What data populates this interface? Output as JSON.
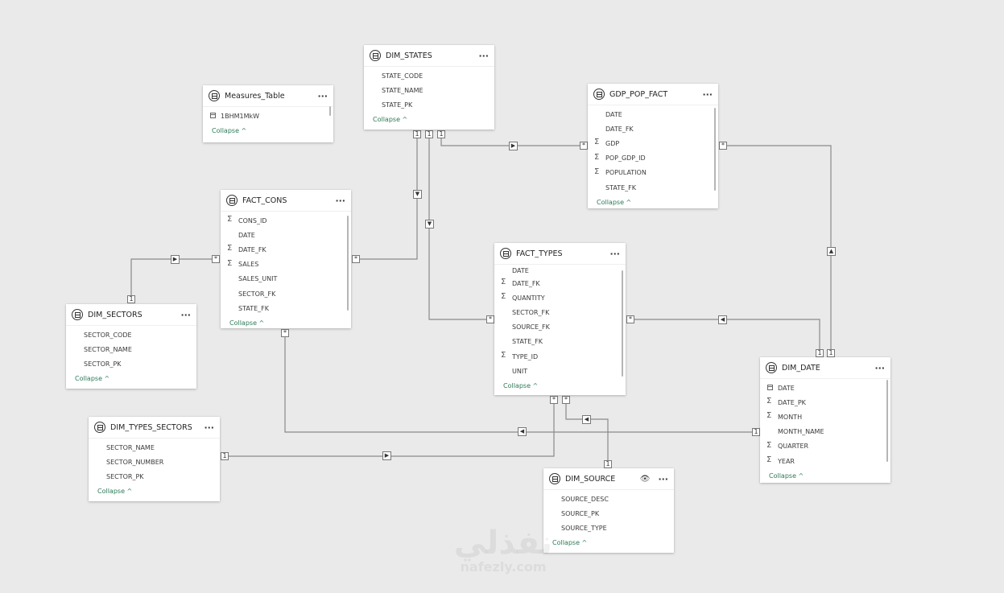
{
  "tables": [
    {
      "id": "dim_states",
      "title": "DIM_STATES",
      "fields": [
        {
          "name": "STATE_CODE",
          "icon": ""
        },
        {
          "name": "STATE_NAME",
          "icon": ""
        },
        {
          "name": "STATE_PK",
          "icon": ""
        }
      ],
      "collapse": "Collapse ^"
    },
    {
      "id": "measures_table",
      "title": "Measures_Table",
      "fields": [
        {
          "name": "1BHM1MkW",
          "icon": "calculator"
        }
      ],
      "collapse": "Collapse ^"
    },
    {
      "id": "gdp_pop_fact",
      "title": "GDP_POP_FACT",
      "fields": [
        {
          "name": "DATE",
          "icon": ""
        },
        {
          "name": "DATE_FK",
          "icon": ""
        },
        {
          "name": "GDP",
          "icon": "sigma"
        },
        {
          "name": "POP_GDP_ID",
          "icon": "sigma"
        },
        {
          "name": "POPULATION",
          "icon": "sigma"
        },
        {
          "name": "STATE_FK",
          "icon": ""
        }
      ],
      "collapse": "Collapse ^"
    },
    {
      "id": "fact_cons",
      "title": "FACT_CONS",
      "fields": [
        {
          "name": "CONS_ID",
          "icon": "sigma"
        },
        {
          "name": "DATE",
          "icon": ""
        },
        {
          "name": "DATE_FK",
          "icon": "sigma"
        },
        {
          "name": "SALES",
          "icon": "sigma"
        },
        {
          "name": "SALES_UNIT",
          "icon": ""
        },
        {
          "name": "SECTOR_FK",
          "icon": ""
        },
        {
          "name": "STATE_FK",
          "icon": ""
        }
      ],
      "collapse": "Collapse ^"
    },
    {
      "id": "fact_types",
      "title": "FACT_TYPES",
      "fields": [
        {
          "name": "DATE",
          "icon": ""
        },
        {
          "name": "DATE_FK",
          "icon": "sigma"
        },
        {
          "name": "QUANTITY",
          "icon": "sigma"
        },
        {
          "name": "SECTOR_FK",
          "icon": ""
        },
        {
          "name": "SOURCE_FK",
          "icon": ""
        },
        {
          "name": "STATE_FK",
          "icon": ""
        },
        {
          "name": "TYPE_ID",
          "icon": "sigma"
        },
        {
          "name": "UNIT",
          "icon": ""
        }
      ],
      "collapse": "Collapse ^"
    },
    {
      "id": "dim_sectors",
      "title": "DIM_SECTORS",
      "fields": [
        {
          "name": "SECTOR_CODE",
          "icon": ""
        },
        {
          "name": "SECTOR_NAME",
          "icon": ""
        },
        {
          "name": "SECTOR_PK",
          "icon": ""
        }
      ],
      "collapse": "Collapse ^"
    },
    {
      "id": "dim_date",
      "title": "DIM_DATE",
      "fields": [
        {
          "name": "DATE",
          "icon": "calendar"
        },
        {
          "name": "DATE_PK",
          "icon": "sigma"
        },
        {
          "name": "MONTH",
          "icon": "sigma"
        },
        {
          "name": "MONTH_NAME",
          "icon": ""
        },
        {
          "name": "QUARTER",
          "icon": "sigma"
        },
        {
          "name": "YEAR",
          "icon": "sigma"
        }
      ],
      "collapse": "Collapse ^"
    },
    {
      "id": "dim_types_sectors",
      "title": "DIM_TYPES_SECTORS",
      "fields": [
        {
          "name": "SECTOR_NAME",
          "icon": ""
        },
        {
          "name": "SECTOR_NUMBER",
          "icon": ""
        },
        {
          "name": "SECTOR_PK",
          "icon": ""
        }
      ],
      "collapse": "Collapse ^"
    },
    {
      "id": "dim_source",
      "title": "DIM_SOURCE",
      "fields": [
        {
          "name": "SOURCE_DESC",
          "icon": ""
        },
        {
          "name": "SOURCE_PK",
          "icon": ""
        },
        {
          "name": "SOURCE_TYPE",
          "icon": ""
        }
      ],
      "collapse": "Collapse ^",
      "hidden_icon": "eye-icon"
    }
  ],
  "cardinality": {
    "one": "1",
    "many": "*"
  },
  "more_label": "···",
  "watermark": {
    "line1": "نفذلي",
    "line2": "nafezly.com"
  }
}
